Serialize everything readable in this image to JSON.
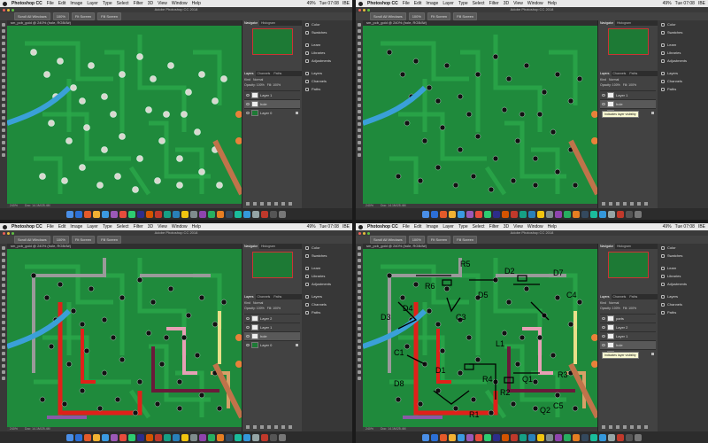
{
  "menubar": {
    "app_name": "Photoshop CC",
    "items": [
      "File",
      "Edit",
      "Image",
      "Layer",
      "Type",
      "Select",
      "Filter",
      "3D",
      "View",
      "Window",
      "Help"
    ],
    "battery": "49%",
    "clock": [
      "Tue 07:08",
      "Tue 07:08",
      "Tue 07:08",
      "Tue 07:08"
    ],
    "user": "IBE"
  },
  "window": {
    "title": "Adobe Photoshop CC 2018"
  },
  "options_bar": {
    "buttons": [
      "Scroll All Windows",
      "100%",
      "Fit Screen",
      "Fill Screen"
    ]
  },
  "document": {
    "tab": "sm_pcb_gold @ 240% (hole, RGB/8#)",
    "status": "Doc: 14.1M/25.4M",
    "zoom": "240%"
  },
  "panels": {
    "tabs": [
      "Navigator",
      "Histogram"
    ],
    "layer_tabs": [
      "Layers",
      "Channels",
      "Paths"
    ],
    "kind_label": "Kind",
    "blend_mode": "Normal",
    "opacity": "Opacity: 100%",
    "fill": "Fill: 100%",
    "layers_q0": [
      "Layer 1",
      "hole",
      "Layer 0"
    ],
    "layers_q1": [
      "Layer 1",
      "hole",
      "Layer 0"
    ],
    "layers_q2": [
      "Layer 2",
      "Layer 1",
      "hole",
      "Layer 0"
    ],
    "layers_q3": [
      "parts",
      "Layer 2",
      "Layer 1",
      "hole",
      "Layer 0"
    ],
    "tooltip": "Indicates layer visibility"
  },
  "dock": {
    "items": [
      "Color",
      "Swatches",
      "Learn",
      "Libraries",
      "Adjustments",
      "Layers",
      "Channels",
      "Paths"
    ]
  },
  "annotations": {
    "labels": [
      "R5",
      "D2",
      "D7",
      "R6",
      "D3",
      "C3",
      "D4",
      "D5",
      "C4",
      "R4",
      "Q1",
      "R3",
      "R1",
      "D1",
      "C1",
      "D8",
      "R2",
      "Q2",
      "C5",
      "L1"
    ]
  },
  "colors": {
    "pcb_green": "#1f8a3c",
    "trace_green": "#2aa84a",
    "trace_red": "#e0201a",
    "trace_blue": "#3aa0d8",
    "trace_gray": "#9a9a9a",
    "trace_pink": "#e7a0b5",
    "trace_maroon": "#6a1a3a",
    "trace_yellow": "#e9e08a",
    "trace_tan": "#d7a067",
    "hole_silver": "#d9d7cf",
    "hole_black": "#111111",
    "annotation_ink": "#000000"
  }
}
